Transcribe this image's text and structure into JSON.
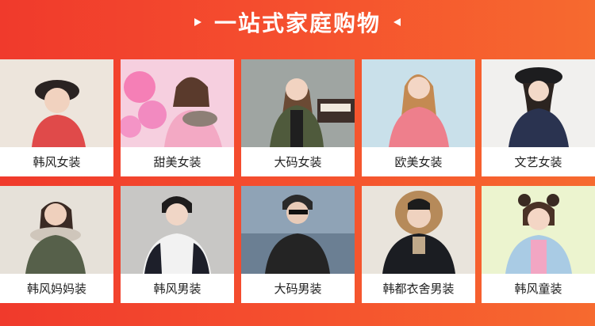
{
  "header": {
    "title": "一站式家庭购物"
  },
  "colors": {
    "accent": "#f03a2c",
    "card_bg": "#ffffff",
    "text": "#222222"
  },
  "categories": [
    {
      "label": "韩风女装"
    },
    {
      "label": "甜美女装"
    },
    {
      "label": "大码女装"
    },
    {
      "label": "欧美女装"
    },
    {
      "label": "文艺女装"
    },
    {
      "label": "韩风妈妈装"
    },
    {
      "label": "韩风男装"
    },
    {
      "label": "大码男装"
    },
    {
      "label": "韩都衣舍男装"
    },
    {
      "label": "韩风童装"
    }
  ]
}
